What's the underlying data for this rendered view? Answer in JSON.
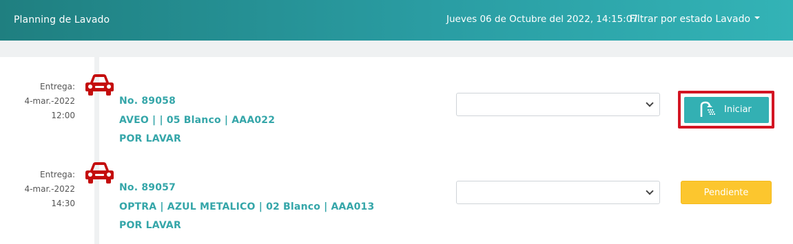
{
  "header": {
    "title": "Planning de Lavado",
    "datetime": "Jueves 06 de Octubre del 2022, 14:15:07",
    "filter_label": "Filtrar por estado Lavado"
  },
  "colors": {
    "header_accent": "#2a9da3",
    "car_icon": "#c40c0c",
    "info_text": "#35a6a9",
    "iniciar_button": "#33b0b3",
    "pendiente_button": "#fcc62e",
    "highlight_border": "#d31523"
  },
  "entries": [
    {
      "delivery_label": "Entrega:",
      "delivery_date": "4-mar.-2022",
      "delivery_time": "12:00",
      "icon": "car-icon",
      "number": "No. 89058",
      "vehicle": "AVEO | | 05 Blanco | AAA022",
      "status": "POR LAVAR",
      "select_value": "",
      "action_label": "Iniciar",
      "action_icon": "shower-icon"
    },
    {
      "delivery_label": "Entrega:",
      "delivery_date": "4-mar.-2022",
      "delivery_time": "14:30",
      "icon": "car-icon",
      "number": "No. 89057",
      "vehicle": "OPTRA | AZUL METALICO | 02 Blanco | AAA013",
      "status": "POR LAVAR",
      "select_value": "",
      "action_label": "Pendiente"
    }
  ]
}
